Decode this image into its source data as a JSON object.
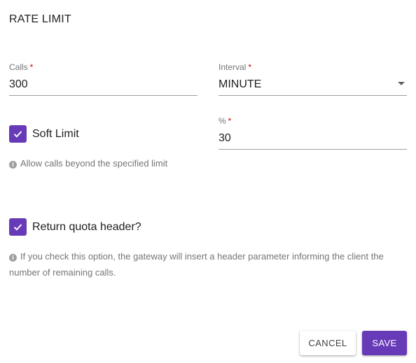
{
  "dialog": {
    "title": "RATE LIMIT"
  },
  "calls": {
    "label": "Calls",
    "required_mark": "*",
    "value": "300"
  },
  "interval": {
    "label": "Interval",
    "required_mark": "*",
    "value": "MINUTE",
    "arrow_icon": "caret-down-icon"
  },
  "percent": {
    "label": "%",
    "required_mark": "*",
    "value": "30"
  },
  "soft_limit": {
    "label": "Soft Limit",
    "checked": true,
    "hint": "Allow calls beyond the specified limit",
    "hint_icon": "info-icon"
  },
  "quota_header": {
    "label": "Return quota header?",
    "checked": true,
    "hint": "If you check this option, the gateway will insert a header parameter informing the client the number of remaining calls.",
    "hint_icon": "info-icon"
  },
  "actions": {
    "cancel_label": "CANCEL",
    "save_label": "SAVE"
  },
  "colors": {
    "accent": "#673ab7",
    "required": "#d50000",
    "hint_text": "#757575"
  }
}
